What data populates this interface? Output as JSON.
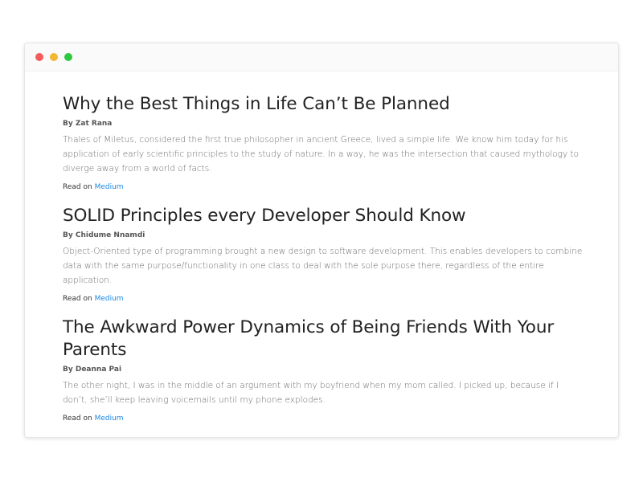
{
  "window": {
    "controls": [
      "close",
      "minimize",
      "maximize"
    ]
  },
  "articles": [
    {
      "title": "Why the Best Things in Life Can’t Be Planned",
      "author": "By Zat Rana",
      "summary": "Thales of Miletus, considered the first true philosopher in ancient Greece, lived a simple life. We know him today for his application of early scientific principles to the study of nature. In a way, he was the intersection that caused mythology to diverge away from a world of facts.",
      "read_prefix": "Read on",
      "source": "Medium"
    },
    {
      "title": "SOLID Principles every Developer Should Know",
      "author": "By Chidume Nnamdi",
      "summary": "Object-Oriented type of programming brought a new design to software development. This enables developers to combine data with the same purpose/functionality in one class to deal with the sole purpose there, regardless of the entire application.",
      "read_prefix": "Read on",
      "source": "Medium"
    },
    {
      "title": "The Awkward Power Dynamics of Being Friends With Your Parents",
      "author": "By Deanna Pai",
      "summary": "The other night, I was in the middle of an argument with my boyfriend when my mom called. I picked up, because if I don’t, she’ll keep leaving voicemails until my phone explodes.",
      "read_prefix": "Read on",
      "source": "Medium"
    }
  ],
  "colors": {
    "close": "#f45b5b",
    "minimize": "#f5b731",
    "maximize": "#2fc740",
    "link": "#1e88e5"
  }
}
